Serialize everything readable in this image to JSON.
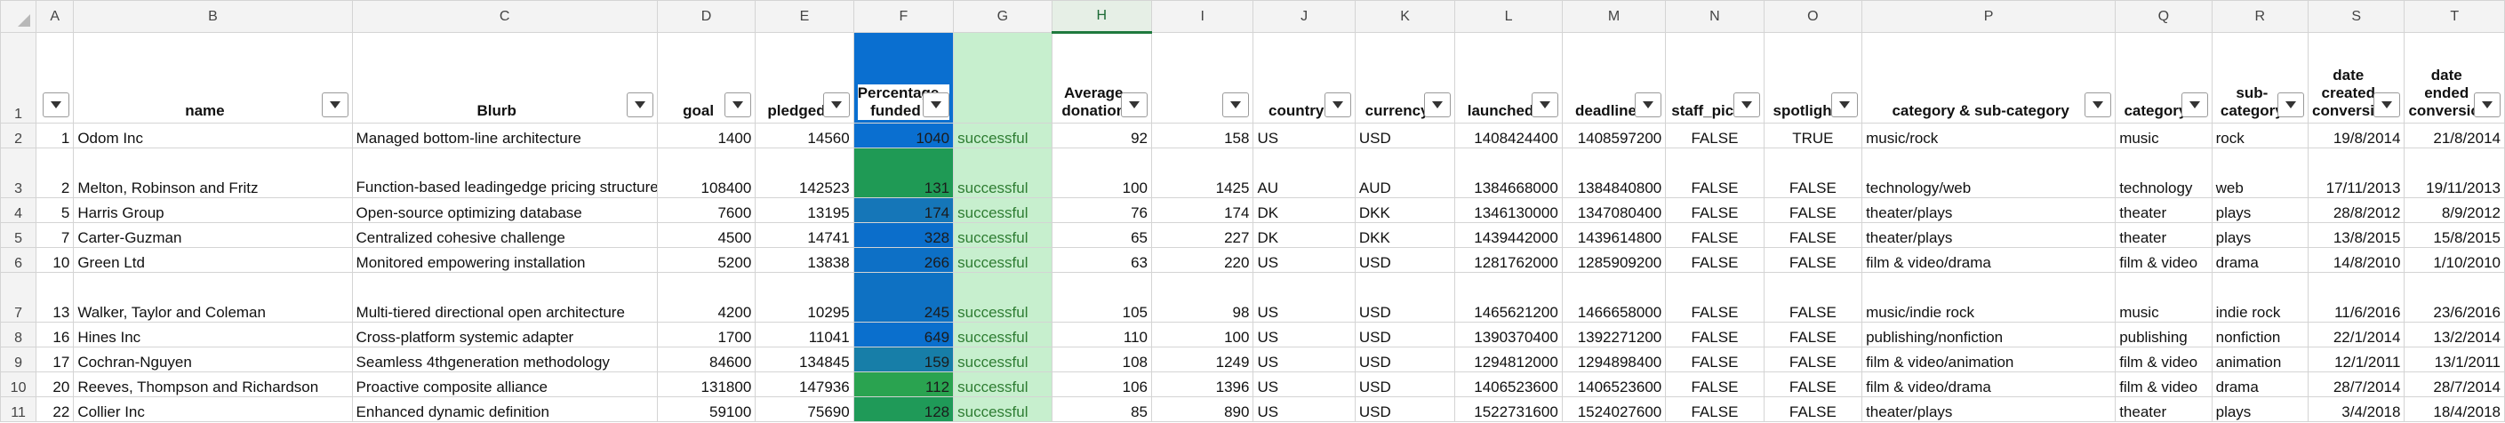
{
  "columns": [
    "A",
    "B",
    "C",
    "D",
    "E",
    "F",
    "G",
    "H",
    "I",
    "J",
    "K",
    "L",
    "M",
    "N",
    "O",
    "P",
    "Q",
    "R",
    "S",
    "T"
  ],
  "selected_column": "H",
  "row_numbers": [
    "1",
    "2",
    "3",
    "4",
    "5",
    "6",
    "7",
    "8",
    "9",
    "10",
    "11"
  ],
  "headers": [
    "",
    "name",
    "Blurb",
    "goal",
    "pledged",
    "Percentage funded",
    "",
    "Average donation",
    "",
    "country",
    "currency",
    "launched",
    "deadline",
    "staff_pick",
    "spotlight",
    "category & sub-category",
    "category",
    "sub-category",
    "date created conversion",
    "date ended conversion"
  ],
  "colors": {
    "outcome_fill": "#c7efce",
    "outcome_text": "#2e7d32",
    "blue_scale": "#0a6fc9",
    "green_scale": "#2fa44f",
    "header_select": "#1f7a3e"
  },
  "rows": [
    {
      "id": "1",
      "name": "Odom Inc",
      "blurb": "Managed bottom-line architecture",
      "goal": "1400",
      "pledged": "14560",
      "pct": "1040",
      "pct_color": "#0a6fd0",
      "outcome": "successful",
      "avg": "92",
      "backers": "158",
      "country": "US",
      "currency": "USD",
      "launched": "1408424400",
      "deadline": "1408597200",
      "staff": "FALSE",
      "spot": "TRUE",
      "catsub": "music/rock",
      "cat": "music",
      "sub": "rock",
      "created": "19/8/2014",
      "ended": "21/8/2014"
    },
    {
      "id": "2",
      "name": "Melton, Robinson and Fritz",
      "blurb": "Function-based leadingedge pricing structure",
      "goal": "108400",
      "pledged": "142523",
      "pct": "131",
      "pct_color": "#1f9a55",
      "outcome": "successful",
      "avg": "100",
      "backers": "1425",
      "country": "AU",
      "currency": "AUD",
      "launched": "1384668000",
      "deadline": "1384840800",
      "staff": "FALSE",
      "spot": "FALSE",
      "catsub": "technology/web",
      "cat": "technology",
      "sub": "web",
      "created": "17/11/2013",
      "ended": "19/11/2013"
    },
    {
      "id": "5",
      "name": "Harris Group",
      "blurb": "Open-source optimizing database",
      "goal": "7600",
      "pledged": "13195",
      "pct": "174",
      "pct_color": "#1576b8",
      "outcome": "successful",
      "avg": "76",
      "backers": "174",
      "country": "DK",
      "currency": "DKK",
      "launched": "1346130000",
      "deadline": "1347080400",
      "staff": "FALSE",
      "spot": "FALSE",
      "catsub": "theater/plays",
      "cat": "theater",
      "sub": "plays",
      "created": "28/8/2012",
      "ended": "8/9/2012"
    },
    {
      "id": "7",
      "name": "Carter-Guzman",
      "blurb": "Centralized cohesive challenge",
      "goal": "4500",
      "pledged": "14741",
      "pct": "328",
      "pct_color": "#0b6ecb",
      "outcome": "successful",
      "avg": "65",
      "backers": "227",
      "country": "DK",
      "currency": "DKK",
      "launched": "1439442000",
      "deadline": "1439614800",
      "staff": "FALSE",
      "spot": "FALSE",
      "catsub": "theater/plays",
      "cat": "theater",
      "sub": "plays",
      "created": "13/8/2015",
      "ended": "15/8/2015"
    },
    {
      "id": "10",
      "name": "Green Ltd",
      "blurb": "Monitored empowering installation",
      "goal": "5200",
      "pledged": "13838",
      "pct": "266",
      "pct_color": "#0d70c6",
      "outcome": "successful",
      "avg": "63",
      "backers": "220",
      "country": "US",
      "currency": "USD",
      "launched": "1281762000",
      "deadline": "1285909200",
      "staff": "FALSE",
      "spot": "FALSE",
      "catsub": "film & video/drama",
      "cat": "film & video",
      "sub": "drama",
      "created": "14/8/2010",
      "ended": "1/10/2010"
    },
    {
      "id": "13",
      "name": "Walker, Taylor and Coleman",
      "blurb": "Multi-tiered directional open architecture",
      "goal": "4200",
      "pledged": "10295",
      "pct": "245",
      "pct_color": "#0e71c3",
      "outcome": "successful",
      "avg": "105",
      "backers": "98",
      "country": "US",
      "currency": "USD",
      "launched": "1465621200",
      "deadline": "1466658000",
      "staff": "FALSE",
      "spot": "FALSE",
      "catsub": "music/indie rock",
      "cat": "music",
      "sub": "indie rock",
      "created": "11/6/2016",
      "ended": "23/6/2016"
    },
    {
      "id": "16",
      "name": "Hines Inc",
      "blurb": "Cross-platform systemic adapter",
      "goal": "1700",
      "pledged": "11041",
      "pct": "649",
      "pct_color": "#0a6fcd",
      "outcome": "successful",
      "avg": "110",
      "backers": "100",
      "country": "US",
      "currency": "USD",
      "launched": "1390370400",
      "deadline": "1392271200",
      "staff": "FALSE",
      "spot": "FALSE",
      "catsub": "publishing/nonfiction",
      "cat": "publishing",
      "sub": "nonfiction",
      "created": "22/1/2014",
      "ended": "13/2/2014"
    },
    {
      "id": "17",
      "name": "Cochran-Nguyen",
      "blurb": "Seamless 4thgeneration methodology",
      "goal": "84600",
      "pledged": "134845",
      "pct": "159",
      "pct_color": "#177ea8",
      "outcome": "successful",
      "avg": "108",
      "backers": "1249",
      "country": "US",
      "currency": "USD",
      "launched": "1294812000",
      "deadline": "1294898400",
      "staff": "FALSE",
      "spot": "FALSE",
      "catsub": "film & video/animation",
      "cat": "film & video",
      "sub": "animation",
      "created": "12/1/2011",
      "ended": "13/1/2011"
    },
    {
      "id": "20",
      "name": "Reeves, Thompson and Richardson",
      "blurb": "Proactive composite alliance",
      "goal": "131800",
      "pledged": "147936",
      "pct": "112",
      "pct_color": "#2aa350",
      "outcome": "successful",
      "avg": "106",
      "backers": "1396",
      "country": "US",
      "currency": "USD",
      "launched": "1406523600",
      "deadline": "1406523600",
      "staff": "FALSE",
      "spot": "FALSE",
      "catsub": "film & video/drama",
      "cat": "film & video",
      "sub": "drama",
      "created": "28/7/2014",
      "ended": "28/7/2014"
    },
    {
      "id": "22",
      "name": "Collier Inc",
      "blurb": "Enhanced dynamic definition",
      "goal": "59100",
      "pledged": "75690",
      "pct": "128",
      "pct_color": "#1f9a58",
      "outcome": "successful",
      "avg": "85",
      "backers": "890",
      "country": "US",
      "currency": "USD",
      "launched": "1522731600",
      "deadline": "1524027600",
      "staff": "FALSE",
      "spot": "FALSE",
      "catsub": "theater/plays",
      "cat": "theater",
      "sub": "plays",
      "created": "3/4/2018",
      "ended": "18/4/2018"
    }
  ]
}
